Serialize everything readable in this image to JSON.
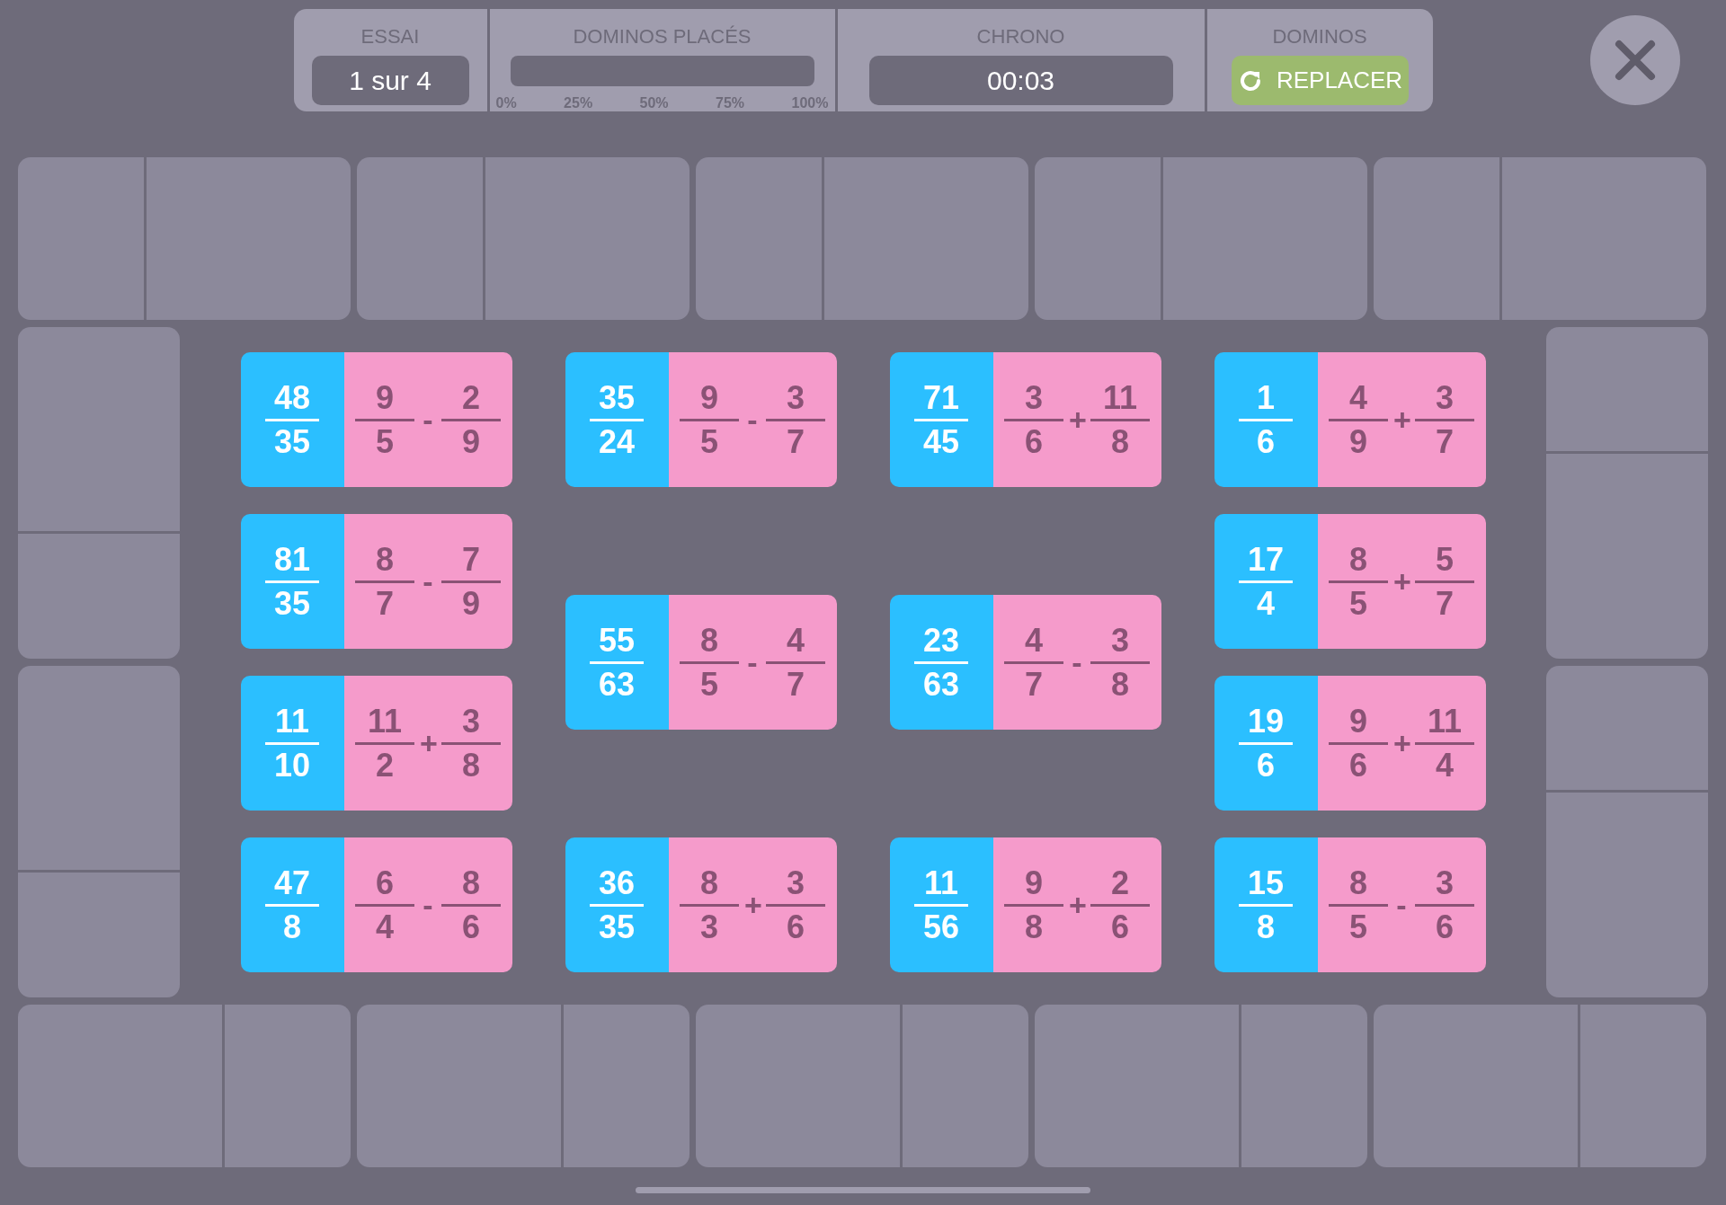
{
  "header": {
    "trial": {
      "label": "ESSAI",
      "value": "1 sur 4"
    },
    "progress": {
      "label": "DOMINOS PLACÉS",
      "level": 0,
      "ticks": [
        "0%",
        "25%",
        "50%",
        "75%",
        "100%"
      ]
    },
    "timer": {
      "label": "CHRONO",
      "value": "00:03"
    },
    "dominos": {
      "label": "DOMINOS",
      "button": "REPLACER"
    }
  },
  "domino_columns": [
    [
      {
        "result": {
          "num": "48",
          "den": "35"
        },
        "left": {
          "num": "9",
          "den": "5"
        },
        "op": "-",
        "right": {
          "num": "2",
          "den": "9"
        }
      },
      {
        "result": {
          "num": "81",
          "den": "35"
        },
        "left": {
          "num": "8",
          "den": "7"
        },
        "op": "-",
        "right": {
          "num": "7",
          "den": "9"
        }
      },
      {
        "result": {
          "num": "11",
          "den": "10"
        },
        "left": {
          "num": "11",
          "den": "2"
        },
        "op": "+",
        "right": {
          "num": "3",
          "den": "8"
        }
      },
      {
        "result": {
          "num": "47",
          "den": "8"
        },
        "left": {
          "num": "6",
          "den": "4"
        },
        "op": "-",
        "right": {
          "num": "8",
          "den": "6"
        }
      }
    ],
    [
      {
        "result": {
          "num": "35",
          "den": "24"
        },
        "left": {
          "num": "9",
          "den": "5"
        },
        "op": "-",
        "right": {
          "num": "3",
          "den": "7"
        }
      },
      {
        "result": {
          "num": "55",
          "den": "63"
        },
        "left": {
          "num": "8",
          "den": "5"
        },
        "op": "-",
        "right": {
          "num": "4",
          "den": "7"
        }
      },
      {
        "result": {
          "num": "36",
          "den": "35"
        },
        "left": {
          "num": "8",
          "den": "3"
        },
        "op": "+",
        "right": {
          "num": "3",
          "den": "6"
        }
      }
    ],
    [
      {
        "result": {
          "num": "71",
          "den": "45"
        },
        "left": {
          "num": "3",
          "den": "6"
        },
        "op": "+",
        "right": {
          "num": "11",
          "den": "8"
        }
      },
      {
        "result": {
          "num": "23",
          "den": "63"
        },
        "left": {
          "num": "4",
          "den": "7"
        },
        "op": "-",
        "right": {
          "num": "3",
          "den": "8"
        }
      },
      {
        "result": {
          "num": "11",
          "den": "56"
        },
        "left": {
          "num": "9",
          "den": "8"
        },
        "op": "+",
        "right": {
          "num": "2",
          "den": "6"
        }
      }
    ],
    [
      {
        "result": {
          "num": "1",
          "den": "6"
        },
        "left": {
          "num": "4",
          "den": "9"
        },
        "op": "+",
        "right": {
          "num": "3",
          "den": "7"
        }
      },
      {
        "result": {
          "num": "17",
          "den": "4"
        },
        "left": {
          "num": "8",
          "den": "5"
        },
        "op": "+",
        "right": {
          "num": "5",
          "den": "7"
        }
      },
      {
        "result": {
          "num": "19",
          "den": "6"
        },
        "left": {
          "num": "9",
          "den": "6"
        },
        "op": "+",
        "right": {
          "num": "11",
          "den": "4"
        }
      },
      {
        "result": {
          "num": "15",
          "den": "8"
        },
        "left": {
          "num": "8",
          "den": "5"
        },
        "op": "-",
        "right": {
          "num": "3",
          "den": "6"
        }
      }
    ]
  ]
}
